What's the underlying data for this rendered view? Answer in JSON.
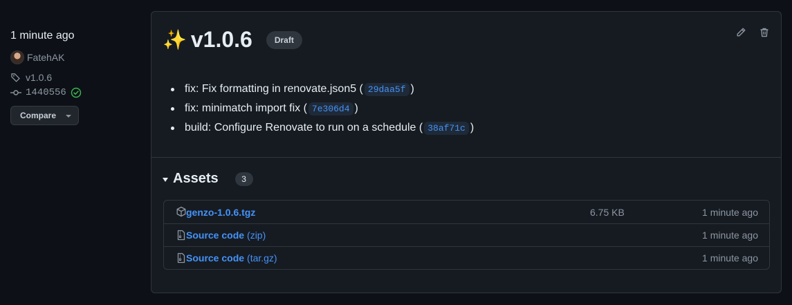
{
  "sidebar": {
    "time": "1 minute ago",
    "author": "FatehAK",
    "tag": "v1.0.6",
    "commit": "1440556",
    "compare_label": "Compare"
  },
  "release": {
    "emoji": "✨",
    "title": "v1.0.6",
    "badge": "Draft",
    "notes": [
      {
        "text": "fix: Fix formatting in renovate.json5 (",
        "sha": "29daa5f",
        "close": ")"
      },
      {
        "text": "fix: minimatch import fix (",
        "sha": "7e306d4",
        "close": ")"
      },
      {
        "text": "build: Configure Renovate to run on a schedule (",
        "sha": "38af71c",
        "close": ")"
      }
    ]
  },
  "assets": {
    "label": "Assets",
    "count": "3",
    "items": [
      {
        "name": "genzo-1.0.6.tgz",
        "suffix": "",
        "size": "6.75 KB",
        "time": "1 minute ago",
        "icon": "package-icon"
      },
      {
        "name": "Source code",
        "suffix": "(zip)",
        "size": "",
        "time": "1 minute ago",
        "icon": "file-zip-icon"
      },
      {
        "name": "Source code",
        "suffix": "(tar.gz)",
        "size": "",
        "time": "1 minute ago",
        "icon": "file-zip-icon"
      }
    ]
  },
  "colors": {
    "background": "#0d1117",
    "card": "#161b22",
    "border": "#30363d",
    "link": "#4493f8",
    "success": "#3fb950",
    "muted": "#8d96a0"
  }
}
